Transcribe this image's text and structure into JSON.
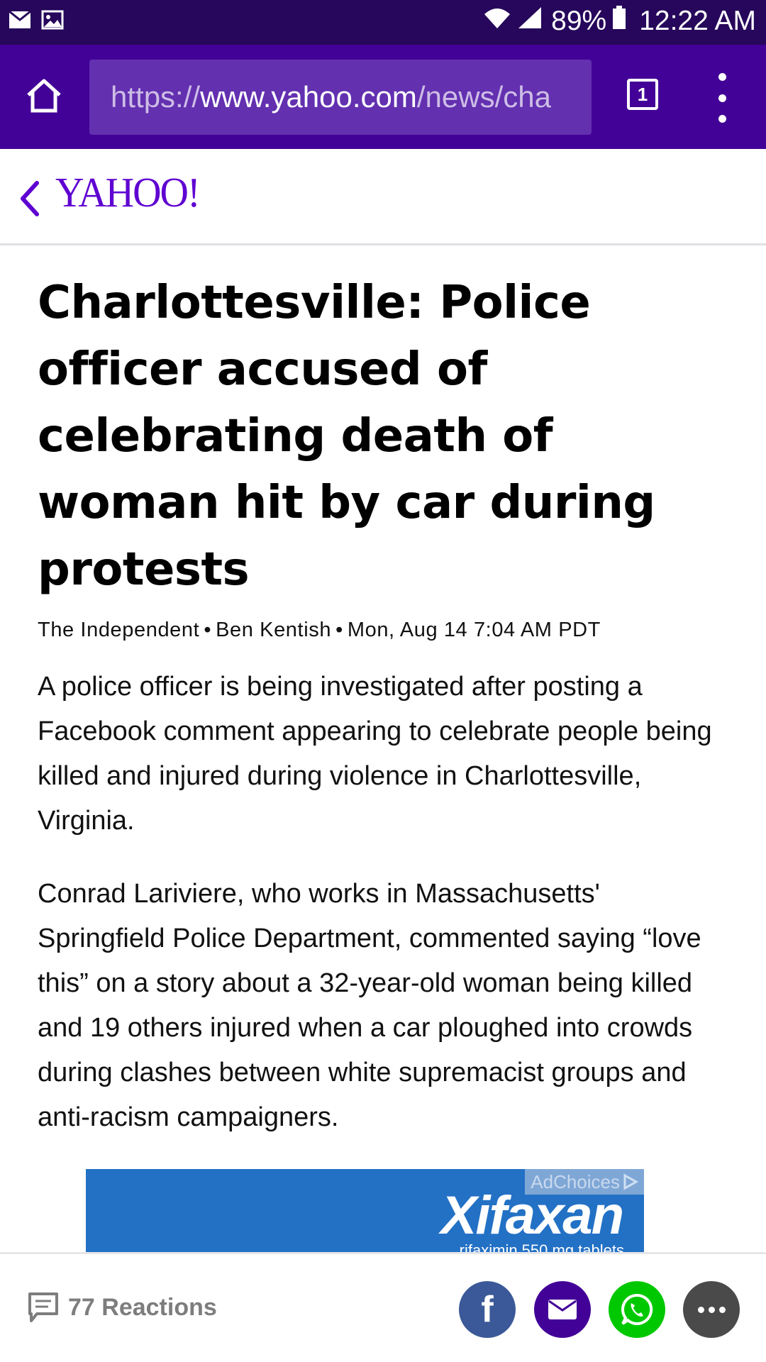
{
  "status_bar": {
    "battery": "89%",
    "time": "12:22 AM"
  },
  "browser": {
    "url_prefix": "https://",
    "url_host": "www.yahoo.com",
    "url_path": "/news/cha",
    "tab_count": "1"
  },
  "site": {
    "logo_text": "YAHOO!"
  },
  "article": {
    "headline": "Charlottesville: Police officer accused of celebrating death of woman hit by car during protests",
    "source": "The Independent",
    "author": "Ben Kentish",
    "date": "Mon, Aug 14 7:04 AM PDT",
    "paragraphs": [
      "A police officer is being investigated after posting a Facebook comment appearing to celebrate people being killed and injured during violence in Charlottesville, Virginia.",
      "Conrad Lariviere, who works in Massachusetts' Springfield Police Department, commented saying “love this” on a story about a 32-year-old woman being killed and 19 others injured when a car ploughed into crowds during clashes between white supremacist groups and anti-racism campaigners."
    ]
  },
  "ad": {
    "adchoices_label": "AdChoices",
    "brand": "Xifaxan",
    "subtitle": "rifaximin 550 mg tablets"
  },
  "share_bar": {
    "reactions_label": "77 Reactions",
    "facebook_glyph": "f"
  },
  "colors": {
    "status_bar": "#26075b",
    "toolbar": "#430297",
    "url_bar": "#6330b0",
    "yahoo_purple": "#5f01d1",
    "facebook": "#3b5998",
    "whatsapp": "#00c800",
    "more": "#4a4a4a",
    "ad_blue": "#2371c5"
  }
}
